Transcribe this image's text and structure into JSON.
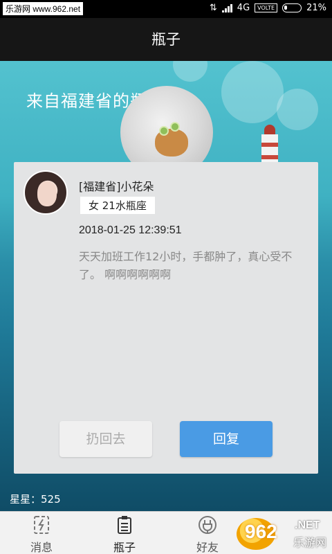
{
  "statusbar": {
    "watermark": "乐游网 www.962.net",
    "network": "4G",
    "volte": "VOLTE",
    "battery": "21%",
    "battery_level": 0.21
  },
  "titlebar": {
    "title": "瓶子"
  },
  "bottle": {
    "source_title": "来自福建省的瓶子"
  },
  "dialog": {
    "sender_name": "[福建省]小花朵",
    "sender_tag": "女 21水瓶座",
    "timestamp": "2018-01-25 12:39:51",
    "message": "天天加班工作12小时，手都肿了，真心受不了。 啊啊啊啊啊啊",
    "throw_back_label": "扔回去",
    "reply_label": "回复"
  },
  "footer": {
    "stars_text": "星星：525"
  },
  "tabs": [
    {
      "label": "消息",
      "icon": "message-icon"
    },
    {
      "label": "瓶子",
      "icon": "bottle-icon",
      "active": true
    },
    {
      "label": "好友",
      "icon": "friends-icon"
    }
  ],
  "watermark_logo": {
    "number": "962",
    "suffix": ".NET",
    "text": "乐游网"
  },
  "colors": {
    "reply_button": "#4a9be4",
    "title_bar": "#161616"
  }
}
